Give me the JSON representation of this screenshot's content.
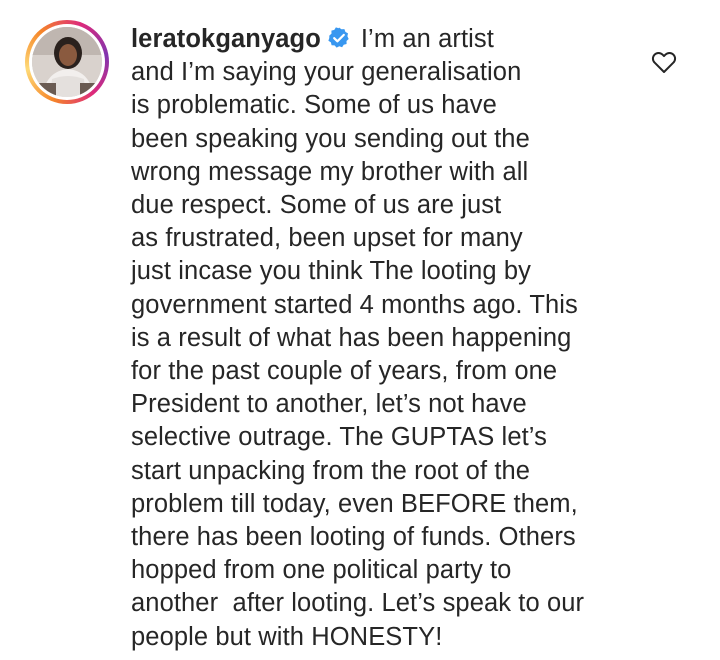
{
  "comment": {
    "username": "leratokganyago",
    "verified": true,
    "first_line_text": "I’m an artist",
    "lines": [
      "and I’m saying your generalisation",
      "is problematic. Some of us have",
      "been speaking you sending out the",
      "wrong message my brother with all",
      "due respect. Some of us are just",
      "as frustrated, been upset for many",
      "just incase you think The looting by",
      "government started 4 months ago. This",
      "is a result of what has been happening",
      "for the past couple of years, from one",
      "President to another, let’s not have",
      "selective outrage. The GUPTAS let’s",
      "start unpacking from the root of the",
      "problem till today, even BEFORE them,",
      "there has been looting of funds. Others",
      "hopped from one political party to",
      "another  after looting. Let’s speak to our",
      "people but with HONESTY!"
    ]
  },
  "icons": {
    "verified": "verified-badge-icon",
    "like": "heart-outline-icon"
  },
  "colors": {
    "text": "#262626",
    "verified_badge": "#3897f0",
    "like_icon": "#262626",
    "background": "#ffffff"
  }
}
